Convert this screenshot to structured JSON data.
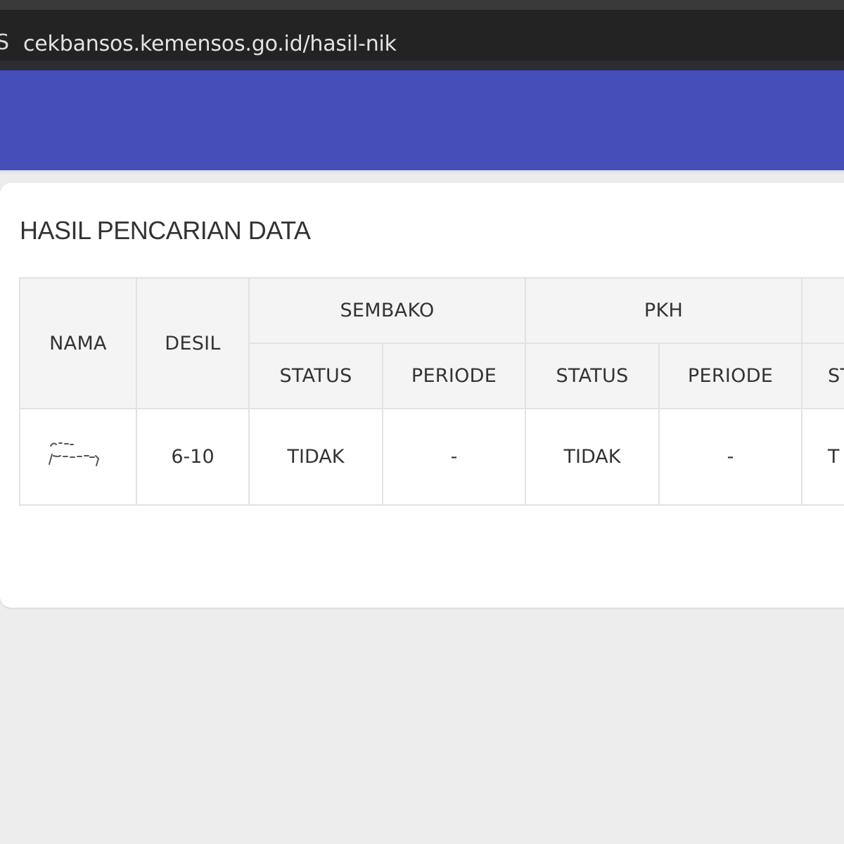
{
  "browser": {
    "url": "cekbansos.kemensos.go.id/hasil-nik",
    "site_icon": "S"
  },
  "page": {
    "title": "HASIL PENCARIAN DATA"
  },
  "table": {
    "headers": {
      "nama": "NAMA",
      "desil": "DESIL",
      "groups": [
        "SEMBAKO",
        "PKH"
      ],
      "sub": [
        "STATUS",
        "PERIODE",
        "STATUS",
        "PERIODE",
        "ST"
      ]
    },
    "rows": [
      {
        "nama": "",
        "desil": "6-10",
        "sembako_status": "TIDAK",
        "sembako_periode": "-",
        "pkh_status": "TIDAK",
        "pkh_periode": "-",
        "next_status": "T"
      }
    ]
  },
  "colors": {
    "header_bar": "#434eb8",
    "chrome": "#232323",
    "background": "#ededed"
  }
}
